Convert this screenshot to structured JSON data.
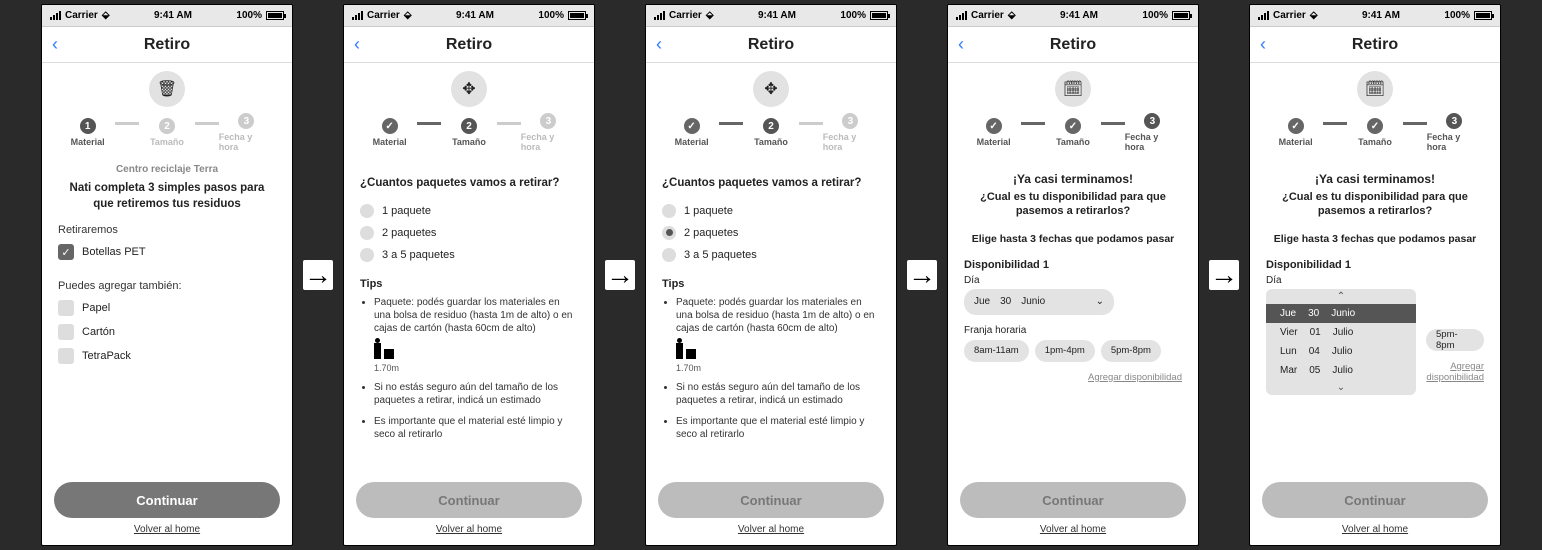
{
  "status": {
    "carrier": "Carrier",
    "time": "9:41 AM",
    "battery": "100%"
  },
  "nav": {
    "title": "Retiro"
  },
  "steps": {
    "s1": "Material",
    "s2": "Tamaño",
    "s3": "Fecha y hora"
  },
  "screen1": {
    "hero": "trash",
    "subtitle": "Centro reciclaje Terra",
    "lead": "Nati completa 3 simples pasos para que retiremos tus residuos",
    "retLabel": "Retiraremos",
    "checked": "Botellas PET",
    "addLabel": "Puedes agregar también:",
    "opts": [
      "Papel",
      "Cartón",
      "TetraPack"
    ]
  },
  "screen2": {
    "hero": "move",
    "lead": "¿Cuantos paquetes vamos a retirar?",
    "opts": [
      "1 paquete",
      "2 paquetes",
      "3 a 5 paquetes"
    ],
    "tipsTitle": "Tips",
    "tips": [
      "Paquete: podés guardar los materiales en una bolsa de residuo (hasta 1m de alto) o en cajas de cartón (hasta 60cm de alto)",
      "Si no estás seguro aún del tamaño de los paquetes a retirar, indicá un estimado",
      "Es importante que el material esté limpio y seco al retirarlo"
    ],
    "scale": "1.70m"
  },
  "screen4": {
    "hero": "calendar",
    "title": "¡Ya casi terminamos!",
    "sub": "¿Cual es tu disponibilidad para que pasemos a retirarlos?",
    "note": "Elige hasta 3 fechas que podamos pasar",
    "group": "Disponibilidad 1",
    "dayLabel": "Día",
    "ddDay": "Jue",
    "ddNum": "30",
    "ddMonth": "Junio",
    "slotLabel": "Franja horaria",
    "slots": [
      "8am-11am",
      "1pm-4pm",
      "5pm-8pm"
    ],
    "add": "Agregar disponibilidad"
  },
  "screen5": {
    "options": [
      {
        "d": "Jue",
        "n": "30",
        "m": "Junio"
      },
      {
        "d": "Vier",
        "n": "01",
        "m": "Julio"
      },
      {
        "d": "Lun",
        "n": "04",
        "m": "Julio"
      },
      {
        "d": "Mar",
        "n": "05",
        "m": "Julio"
      }
    ]
  },
  "buttons": {
    "continue": "Continuar",
    "home": "Volver al home"
  }
}
